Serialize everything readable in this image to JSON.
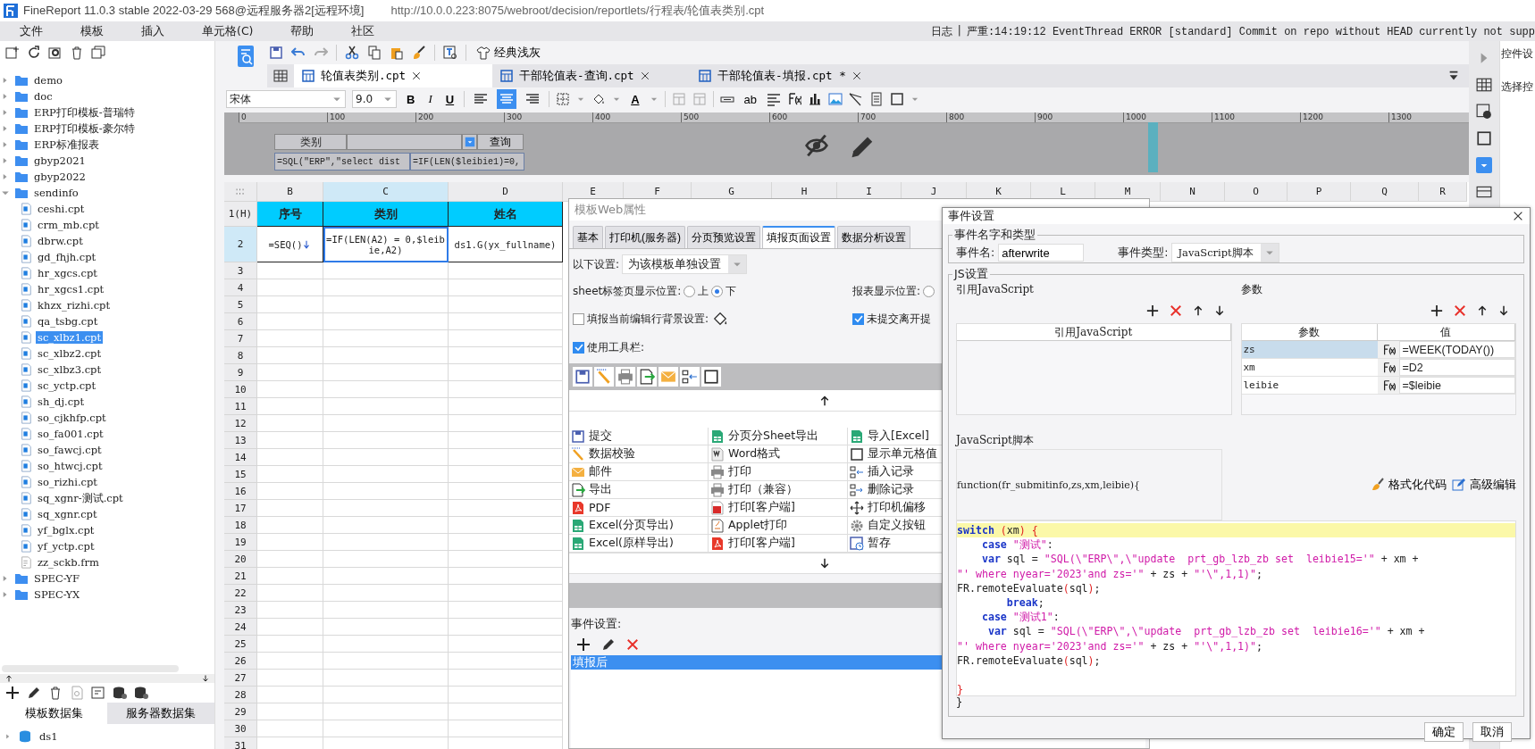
{
  "window": {
    "title": "FineReport 11.0.3 stable 2022-03-29 568@远程服务器2[远程环境]",
    "url": "http://10.0.0.223:8075/webroot/decision/reportlets/行程表/轮值表类别.cpt"
  },
  "menu": [
    "文件",
    "模板",
    "插入",
    "单元格(C)",
    "帮助",
    "社区"
  ],
  "log": {
    "label": "日志",
    "separator": "|",
    "message": "严重:14:19:12 EventThread ERROR [standard] Commit on repo without HEAD currently not supp"
  },
  "tree": [
    {
      "label": "demo",
      "kind": "folder",
      "expanded": false,
      "selected": false
    },
    {
      "label": "doc",
      "kind": "folder",
      "expanded": false,
      "selected": false
    },
    {
      "label": "ERP打印模板-普瑞特",
      "kind": "folder",
      "expanded": false,
      "selected": false
    },
    {
      "label": "ERP打印模板-豪尔特",
      "kind": "folder",
      "expanded": false,
      "selected": false
    },
    {
      "label": "ERP标准报表",
      "kind": "folder",
      "expanded": false,
      "selected": false
    },
    {
      "label": "gbyp2021",
      "kind": "folder",
      "expanded": false,
      "selected": false
    },
    {
      "label": "gbyp2022",
      "kind": "folder",
      "expanded": false,
      "selected": false
    },
    {
      "label": "sendinfo",
      "kind": "folder",
      "expanded": true,
      "selected": false,
      "children": [
        {
          "label": "ceshi.cpt",
          "kind": "report",
          "selected": false
        },
        {
          "label": "crm_mb.cpt",
          "kind": "report",
          "selected": false
        },
        {
          "label": "dbrw.cpt",
          "kind": "report",
          "selected": false
        },
        {
          "label": "gd_fhjh.cpt",
          "kind": "report",
          "selected": false
        },
        {
          "label": "hr_xgcs.cpt",
          "kind": "report",
          "selected": false
        },
        {
          "label": "hr_xgcs1.cpt",
          "kind": "report",
          "selected": false
        },
        {
          "label": "khzx_rizhi.cpt",
          "kind": "report",
          "selected": false
        },
        {
          "label": "qa_tsbg.cpt",
          "kind": "report",
          "selected": false
        },
        {
          "label": "sc_xlbz1.cpt",
          "kind": "report",
          "selected": true
        },
        {
          "label": "sc_xlbz2.cpt",
          "kind": "report",
          "selected": false
        },
        {
          "label": "sc_xlbz3.cpt",
          "kind": "report",
          "selected": false
        },
        {
          "label": "sc_yctp.cpt",
          "kind": "report",
          "selected": false
        },
        {
          "label": "sh_dj.cpt",
          "kind": "report",
          "selected": false
        },
        {
          "label": "so_cjkhfp.cpt",
          "kind": "report",
          "selected": false
        },
        {
          "label": "so_fa001.cpt",
          "kind": "report",
          "selected": false
        },
        {
          "label": "so_fawcj.cpt",
          "kind": "report",
          "selected": false
        },
        {
          "label": "so_htwcj.cpt",
          "kind": "report",
          "selected": false
        },
        {
          "label": "so_rizhi.cpt",
          "kind": "report",
          "selected": false
        },
        {
          "label": "sq_xgnr-测试.cpt",
          "kind": "report",
          "selected": false
        },
        {
          "label": "sq_xgnr.cpt",
          "kind": "report",
          "selected": false
        },
        {
          "label": "yf_bglx.cpt",
          "kind": "report",
          "selected": false
        },
        {
          "label": "yf_yctp.cpt",
          "kind": "report",
          "selected": false
        },
        {
          "label": "zz_sckb.frm",
          "kind": "form",
          "selected": false
        }
      ]
    },
    {
      "label": "SPEC-YF",
      "kind": "folder",
      "expanded": false,
      "selected": false
    },
    {
      "label": "SPEC-YX",
      "kind": "folder",
      "expanded": false,
      "selected": false
    }
  ],
  "dataset_tabs": [
    {
      "label": "模板数据集",
      "selected": true
    },
    {
      "label": "服务器数据集",
      "selected": false
    }
  ],
  "datasets": [
    {
      "label": "ds1"
    }
  ],
  "toolbar": {
    "theme_button": "经典浅灰"
  },
  "file_tabs": [
    {
      "label": "轮值表类别.cpt",
      "selected": true
    },
    {
      "label": "干部轮值表-查询.cpt",
      "selected": false
    },
    {
      "label": "干部轮值表-填报.cpt *",
      "selected": false
    }
  ],
  "format_bar": {
    "font": "宋体",
    "size": "9.0",
    "bold": "B",
    "italic": "I",
    "underline": "U",
    "font_color": "A",
    "text_field": "ab",
    "alignments": [
      {
        "kind": "left",
        "selected": false
      },
      {
        "kind": "center",
        "selected": true
      },
      {
        "kind": "right",
        "selected": false
      }
    ]
  },
  "ruler": {
    "ticks": [
      "0",
      "100",
      "200",
      "300",
      "400",
      "500",
      "600",
      "700",
      "800",
      "900",
      "1000",
      "1100",
      "1200",
      "1300"
    ]
  },
  "parameter_pane": {
    "label": "类别",
    "button": "查询",
    "formulas": [
      "=SQL(\"ERP\",\"select dist",
      "=IF(LEN($leibie1)=0,"
    ]
  },
  "sheet": {
    "columns": [
      {
        "label": "B",
        "selected": false
      },
      {
        "label": "C",
        "selected": true
      },
      {
        "label": "D",
        "selected": false
      },
      {
        "label": "E",
        "selected": false
      },
      {
        "label": "F",
        "selected": false
      },
      {
        "label": "G",
        "selected": false
      },
      {
        "label": "H",
        "selected": false
      },
      {
        "label": "I",
        "selected": false
      },
      {
        "label": "J",
        "selected": false
      },
      {
        "label": "K",
        "selected": false
      },
      {
        "label": "L",
        "selected": false
      },
      {
        "label": "M",
        "selected": false
      },
      {
        "label": "N",
        "selected": false
      },
      {
        "label": "O",
        "selected": false
      },
      {
        "label": "P",
        "selected": false
      },
      {
        "label": "Q",
        "selected": false
      },
      {
        "label": "R",
        "selected": false
      }
    ],
    "rows": [
      {
        "label": "1(H)",
        "kind": "header",
        "selected": false,
        "cells": [
          {
            "text": "序号",
            "selected": false
          },
          {
            "text": "类别",
            "selected": false
          },
          {
            "text": "姓名",
            "selected": false
          }
        ]
      },
      {
        "label": "2",
        "kind": "data",
        "selected": true,
        "cells": [
          {
            "text": "=SEQ()",
            "selected": false
          },
          {
            "text": "=IF(LEN(A2) = 0,$leibie,A2)",
            "selected": true
          },
          {
            "text": "ds1.G(yx_fullname)",
            "selected": false
          }
        ]
      },
      {
        "label": "3",
        "kind": "empty",
        "selected": false
      },
      {
        "label": "4",
        "kind": "empty",
        "selected": false
      },
      {
        "label": "5",
        "kind": "empty",
        "selected": false
      },
      {
        "label": "6",
        "kind": "empty",
        "selected": false
      },
      {
        "label": "7",
        "kind": "empty",
        "selected": false
      },
      {
        "label": "8",
        "kind": "empty",
        "selected": false
      },
      {
        "label": "9",
        "kind": "empty",
        "selected": false
      },
      {
        "label": "10",
        "kind": "empty",
        "selected": false
      },
      {
        "label": "11",
        "kind": "empty",
        "selected": false
      },
      {
        "label": "12",
        "kind": "empty",
        "selected": false
      },
      {
        "label": "13",
        "kind": "empty",
        "selected": false
      },
      {
        "label": "14",
        "kind": "empty",
        "selected": false
      },
      {
        "label": "15",
        "kind": "empty",
        "selected": false
      },
      {
        "label": "16",
        "kind": "empty",
        "selected": false
      },
      {
        "label": "17",
        "kind": "empty",
        "selected": false
      },
      {
        "label": "18",
        "kind": "empty",
        "selected": false
      },
      {
        "label": "19",
        "kind": "empty",
        "selected": false
      },
      {
        "label": "20",
        "kind": "empty",
        "selected": false
      },
      {
        "label": "21",
        "kind": "empty",
        "selected": false
      },
      {
        "label": "22",
        "kind": "empty",
        "selected": false
      },
      {
        "label": "23",
        "kind": "empty",
        "selected": false
      },
      {
        "label": "24",
        "kind": "empty",
        "selected": false
      },
      {
        "label": "25",
        "kind": "empty",
        "selected": false
      },
      {
        "label": "26",
        "kind": "empty",
        "selected": false
      },
      {
        "label": "27",
        "kind": "empty",
        "selected": false
      },
      {
        "label": "28",
        "kind": "empty",
        "selected": false
      },
      {
        "label": "29",
        "kind": "empty",
        "selected": false
      },
      {
        "label": "30",
        "kind": "empty",
        "selected": false
      },
      {
        "label": "31",
        "kind": "empty",
        "selected": false
      }
    ]
  },
  "right_panel": {
    "title": "控件设",
    "hint": "选择控"
  },
  "web_dialog": {
    "title": "模板Web属性",
    "tabs": [
      {
        "label": "基本",
        "selected": false
      },
      {
        "label": "打印机(服务器)",
        "selected": false
      },
      {
        "label": "分页预览设置",
        "selected": false
      },
      {
        "label": "填报页面设置",
        "selected": true
      },
      {
        "label": "数据分析设置",
        "selected": false
      }
    ],
    "scope_label": "以下设置:",
    "scope_value": "为该模板单独设置",
    "sheet_position": {
      "label": "sheet标签页显示位置:",
      "options": [
        {
          "label": "上",
          "selected": false
        },
        {
          "label": "下",
          "selected": true
        }
      ]
    },
    "report_position": {
      "label": "报表显示位置:",
      "options": [
        {
          "selected": false
        }
      ]
    },
    "edit_row_background": {
      "label": "填报当前编辑行背景设置:",
      "checked": false
    },
    "leave_prompt": {
      "label": "未提交离开提",
      "checked": true
    },
    "use_toolbar": {
      "label": "使用工具栏:",
      "checked": true
    },
    "buttons": [
      {
        "label": "提交",
        "kind": "save"
      },
      {
        "label": "分页分Sheet导出",
        "kind": "excel"
      },
      {
        "label": "导入[Excel]",
        "kind": "excel"
      },
      {
        "label": "数据校验",
        "kind": "wand"
      },
      {
        "label": "Word格式",
        "kind": "word"
      },
      {
        "label": "显示单元格值",
        "kind": "cell"
      },
      {
        "label": "邮件",
        "kind": "mail"
      },
      {
        "label": "打印",
        "kind": "printer"
      },
      {
        "label": "插入记录",
        "kind": "insert"
      },
      {
        "label": "导出",
        "kind": "export"
      },
      {
        "label": "打印（兼容）",
        "kind": "printer"
      },
      {
        "label": "删除记录",
        "kind": "delete"
      },
      {
        "label": "PDF",
        "kind": "pdf"
      },
      {
        "label": "打印[客户端]",
        "kind": "flash"
      },
      {
        "label": "打印机偏移",
        "kind": "move"
      },
      {
        "label": "Excel(分页导出)",
        "kind": "excel"
      },
      {
        "label": "Applet打印",
        "kind": "applet"
      },
      {
        "label": "自定义按钮",
        "kind": "gear"
      },
      {
        "label": "Excel(原样导出)",
        "kind": "excel"
      },
      {
        "label": "打印[客户端]",
        "kind": "pdf"
      },
      {
        "label": "暂存",
        "kind": "saveclock"
      }
    ],
    "event_label": "事件设置:",
    "events": [
      {
        "label": "填报后",
        "selected": true
      }
    ]
  },
  "event_dialog": {
    "title": "事件设置",
    "name_group": "事件名字和类型",
    "name_label": "事件名:",
    "name_value": "afterwrite",
    "type_label": "事件类型:",
    "type_value": "JavaScript脚本",
    "js_group": "JS设置",
    "ref_title": "引用JavaScript",
    "ref_column": "引用JavaScript",
    "params_title": "参数",
    "params_columns": [
      "参数",
      "值"
    ],
    "params": [
      {
        "name": "zs",
        "value": "=WEEK(TODAY())",
        "selected": true
      },
      {
        "name": "xm",
        "value": "=D2",
        "selected": false
      },
      {
        "name": "leibie",
        "value": "=$leibie",
        "selected": false
      }
    ],
    "script_label": "JavaScript脚本",
    "signature": "function(fr_submitinfo,zs,xm,leibie){",
    "format_button": "格式化代码",
    "advanced_button": "高级编辑",
    "code": [
      {
        "current": true,
        "tokens": [
          {
            "kind": "keyword",
            "text": "switch"
          },
          {
            "kind": "brace",
            "text": " ("
          },
          {
            "kind": "plain",
            "text": "xm"
          },
          {
            "kind": "brace",
            "text": ")"
          },
          {
            "kind": "brace",
            "text": " {"
          }
        ]
      },
      {
        "current": false,
        "tokens": [
          {
            "kind": "keyword",
            "text": "    case"
          },
          {
            "kind": "string",
            "text": " \"测试\""
          },
          {
            "kind": "plain",
            "text": ":"
          }
        ]
      },
      {
        "current": false,
        "tokens": [
          {
            "kind": "keyword",
            "text": "    var"
          },
          {
            "kind": "plain",
            "text": " sql = "
          },
          {
            "kind": "string",
            "text": "\"SQL(\\\"ERP\\\",\\\"update  prt_gb_lzb_zb set  leibie15='\""
          },
          {
            "kind": "plain",
            "text": " + xm +"
          }
        ]
      },
      {
        "current": false,
        "tokens": [
          {
            "kind": "string",
            "text": "\"' where nyear='2023'and zs='\""
          },
          {
            "kind": "plain",
            "text": " + zs + "
          },
          {
            "kind": "string",
            "text": "\"'\\\",1,1)\""
          },
          {
            "kind": "plain",
            "text": ";"
          }
        ]
      },
      {
        "current": false,
        "tokens": [
          {
            "kind": "plain",
            "text": "FR.remoteEvaluate"
          },
          {
            "kind": "brace",
            "text": "("
          },
          {
            "kind": "plain",
            "text": "sql"
          },
          {
            "kind": "brace",
            "text": ")"
          },
          {
            "kind": "plain",
            "text": ";"
          }
        ]
      },
      {
        "current": false,
        "tokens": [
          {
            "kind": "keyword",
            "text": "        break"
          },
          {
            "kind": "plain",
            "text": ";"
          }
        ]
      },
      {
        "current": false,
        "tokens": [
          {
            "kind": "keyword",
            "text": "    case"
          },
          {
            "kind": "string",
            "text": " \"测试1\""
          },
          {
            "kind": "plain",
            "text": ":"
          }
        ]
      },
      {
        "current": false,
        "tokens": [
          {
            "kind": "keyword",
            "text": "     var"
          },
          {
            "kind": "plain",
            "text": " sql = "
          },
          {
            "kind": "string",
            "text": "\"SQL(\\\"ERP\\\",\\\"update  prt_gb_lzb_zb set  leibie16='\""
          },
          {
            "kind": "plain",
            "text": " + xm +"
          }
        ]
      },
      {
        "current": false,
        "tokens": [
          {
            "kind": "string",
            "text": "\"' where nyear='2023'and zs='\""
          },
          {
            "kind": "plain",
            "text": " + zs + "
          },
          {
            "kind": "string",
            "text": "\"'\\\",1,1)\""
          },
          {
            "kind": "plain",
            "text": ";"
          }
        ]
      },
      {
        "current": false,
        "tokens": [
          {
            "kind": "plain",
            "text": "FR.remoteEvaluate"
          },
          {
            "kind": "brace",
            "text": "("
          },
          {
            "kind": "plain",
            "text": "sql"
          },
          {
            "kind": "brace",
            "text": ")"
          },
          {
            "kind": "plain",
            "text": ";"
          }
        ]
      },
      {
        "current": false
      },
      {
        "current": false,
        "tokens": [
          {
            "kind": "brace",
            "text": "}"
          }
        ]
      }
    ],
    "closing": "}",
    "buttons": [
      "确定",
      "取消"
    ]
  }
}
